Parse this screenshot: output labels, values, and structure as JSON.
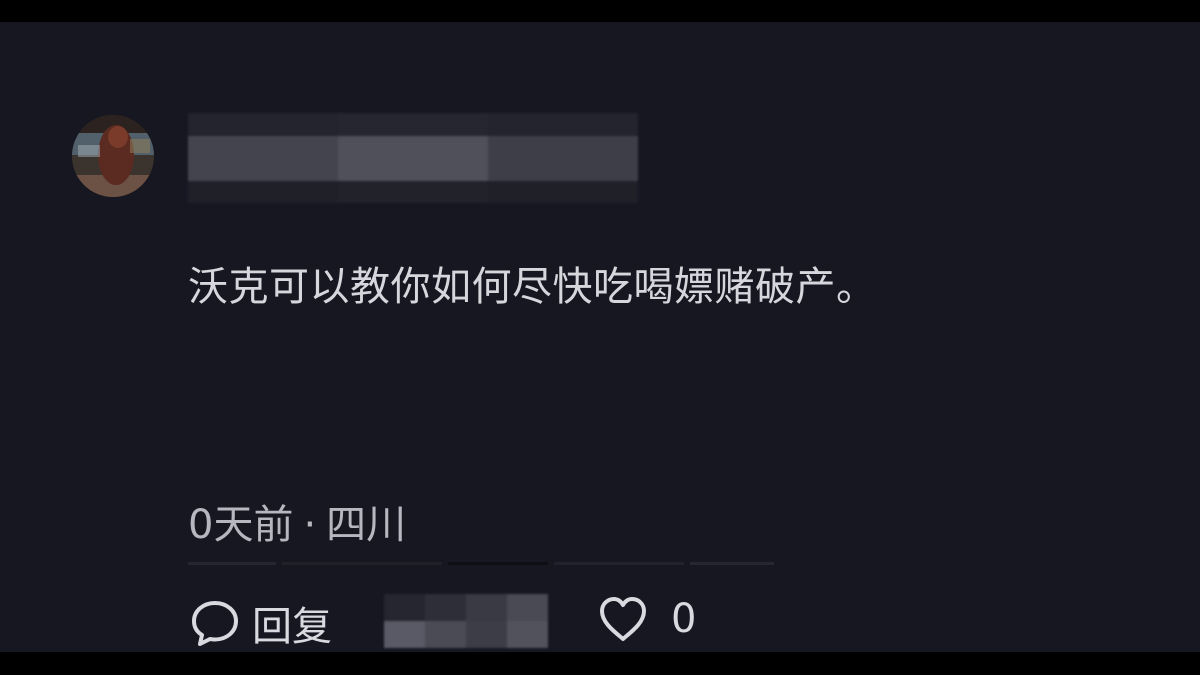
{
  "comment": {
    "text": "沃克可以教你如何尽快吃喝嫖赌破产。",
    "time": "0天前",
    "separator": "·",
    "location": "四川"
  },
  "actions": {
    "reply_label": "回复",
    "like_count": "0"
  },
  "icons": {
    "reply": "speech-bubble-icon",
    "like": "heart-icon"
  },
  "colors": {
    "background": "#171722",
    "text": "#d6d6dc",
    "meta_text": "#b7b7c0"
  }
}
